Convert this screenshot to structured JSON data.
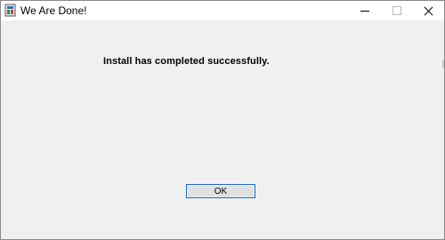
{
  "window": {
    "title": "We Are Done!"
  },
  "titlebar": {
    "icons": {
      "app": "installer-icon",
      "minimize": "minimize-icon",
      "maximize": "maximize-icon",
      "close": "close-icon"
    }
  },
  "content": {
    "message": "Install has completed successfully.",
    "ok_label": "OK"
  },
  "colors": {
    "window_bg": "#f0f0f0",
    "titlebar_bg": "#ffffff",
    "button_border": "#1b6bb7",
    "button_bg": "#e1e1e1"
  }
}
